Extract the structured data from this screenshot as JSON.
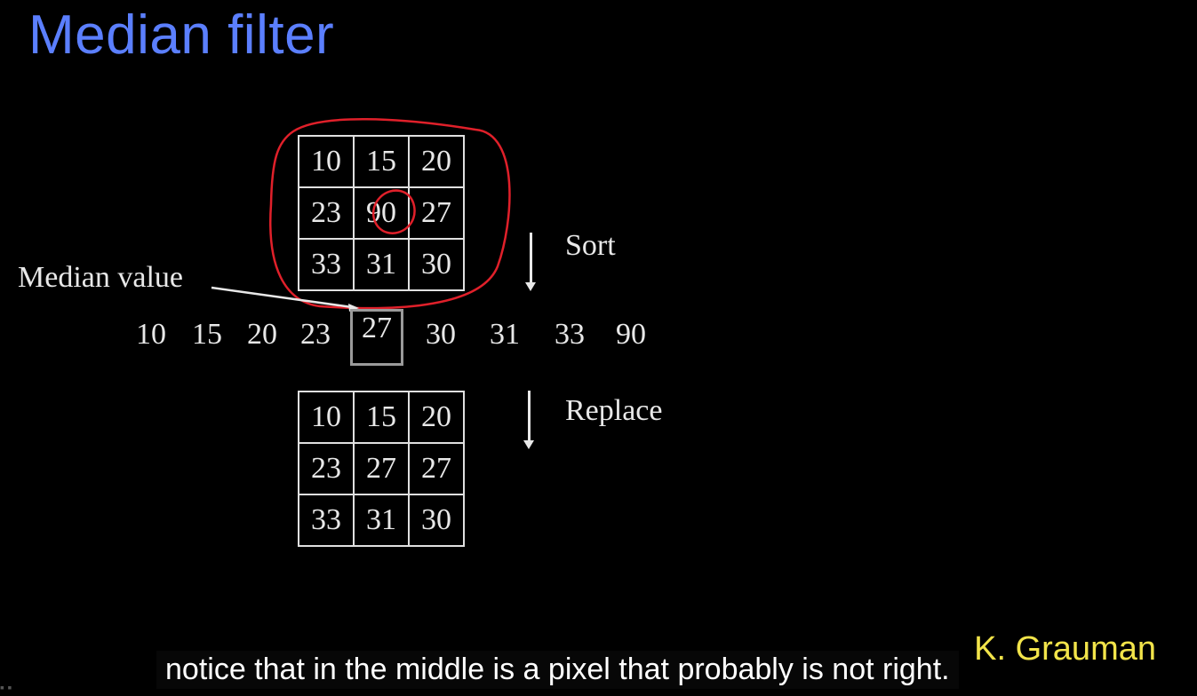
{
  "title": "Median filter",
  "grid_before": [
    [
      "10",
      "15",
      "20"
    ],
    [
      "23",
      "90",
      "27"
    ],
    [
      "33",
      "31",
      "30"
    ]
  ],
  "grid_after": [
    [
      "10",
      "15",
      "20"
    ],
    [
      "23",
      "27",
      "27"
    ],
    [
      "33",
      "31",
      "30"
    ]
  ],
  "sort_label": "Sort",
  "replace_label": "Replace",
  "median_label": "Median value",
  "sorted_values": [
    "10",
    "15",
    "20",
    "23",
    "27",
    "30",
    "31",
    "33",
    "90"
  ],
  "median_index": 4,
  "credit": "K. Grauman",
  "caption": "notice that in the middle is a pixel that probably is not right.",
  "colors": {
    "title": "#5b7fff",
    "annotation": "#e0202a",
    "credit": "#f2e44a"
  }
}
